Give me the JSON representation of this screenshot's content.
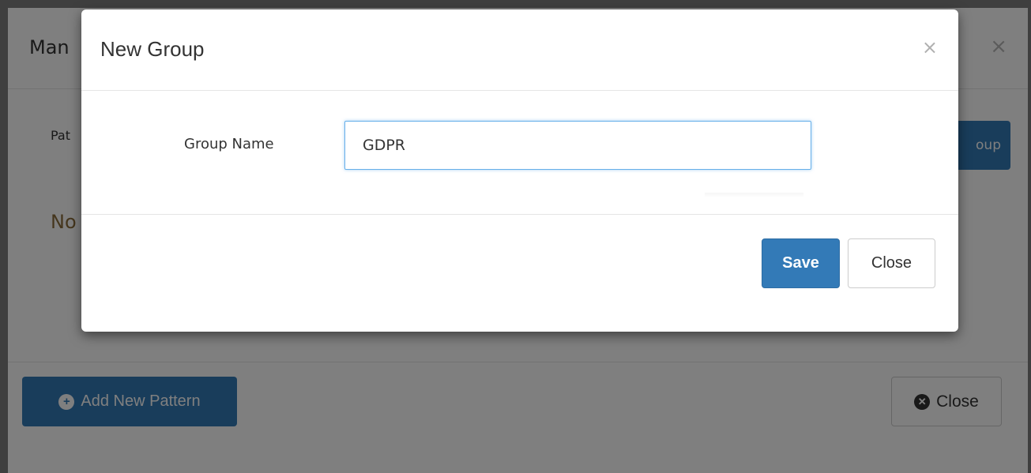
{
  "background_modal": {
    "title": "Man",
    "close_symbol": "×",
    "field_label": "Pat",
    "add_group_label": "oup",
    "status_text": "No",
    "add_pattern_label": "Add New Pattern",
    "add_pattern_icon": "plus-circle-icon",
    "close_label": "Close",
    "close_icon": "x-circle-icon"
  },
  "dialog": {
    "title": "New Group",
    "close_symbol": "×",
    "field_label": "Group Name",
    "field_value": "GDPR",
    "save_label": "Save",
    "close_label": "Close"
  },
  "colors": {
    "primary": "#337ab7",
    "focus_border": "#66afe9",
    "warning_text": "#8a6d3b"
  }
}
